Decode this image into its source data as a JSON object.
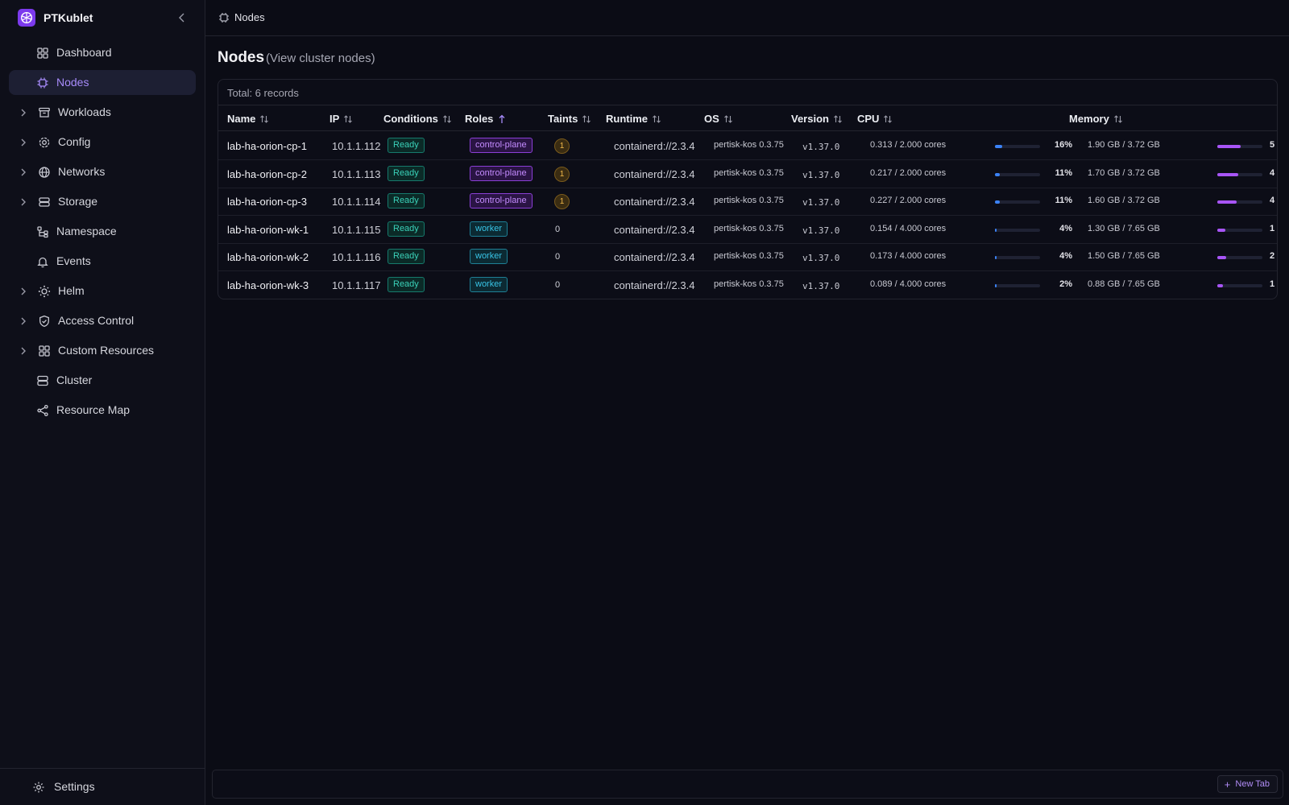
{
  "app": {
    "title": "PTKublet"
  },
  "sidebar": {
    "items": [
      {
        "label": "Dashboard",
        "icon": "dashboard-icon",
        "expandable": false,
        "active": false
      },
      {
        "label": "Nodes",
        "icon": "cpu-chip-icon",
        "expandable": false,
        "active": true
      },
      {
        "label": "Workloads",
        "icon": "archive-box-icon",
        "expandable": true,
        "active": false
      },
      {
        "label": "Config",
        "icon": "gear-icon",
        "expandable": true,
        "active": false
      },
      {
        "label": "Networks",
        "icon": "globe-icon",
        "expandable": true,
        "active": false
      },
      {
        "label": "Storage",
        "icon": "database-icon",
        "expandable": true,
        "active": false
      },
      {
        "label": "Namespace",
        "icon": "namespace-icon",
        "expandable": false,
        "active": false
      },
      {
        "label": "Events",
        "icon": "bell-icon",
        "expandable": false,
        "active": false
      },
      {
        "label": "Helm",
        "icon": "helm-icon",
        "expandable": true,
        "active": false
      },
      {
        "label": "Access Control",
        "icon": "shield-check-icon",
        "expandable": true,
        "active": false
      },
      {
        "label": "Custom Resources",
        "icon": "grid-icon",
        "expandable": true,
        "active": false
      },
      {
        "label": "Cluster",
        "icon": "server-stack-icon",
        "expandable": false,
        "active": false
      },
      {
        "label": "Resource Map",
        "icon": "share-nodes-icon",
        "expandable": false,
        "active": false
      }
    ],
    "footer": {
      "label": "Settings",
      "icon": "gear-icon"
    }
  },
  "breadcrumb": {
    "label": "Nodes",
    "icon": "cpu-chip-icon"
  },
  "page": {
    "title": "Nodes",
    "subtitle": "(View cluster nodes)"
  },
  "table": {
    "total_label": "Total: 6 records",
    "columns": [
      "Name",
      "IP",
      "Conditions",
      "Roles",
      "Taints",
      "Runtime",
      "OS",
      "Version",
      "CPU",
      "Memory"
    ],
    "rows": [
      {
        "name": "lab-ha-orion-cp-1",
        "ip": "10.1.1.112",
        "condition": "Ready",
        "role": "control-plane",
        "taints": "1",
        "runtime": "containerd://2.3.4",
        "os": "pertisk-kos 0.3.75",
        "version": "v1.37.0",
        "cpu": "0.313 / 2.000 cores",
        "cpu_pct": 16,
        "cpu_pct_label": "16%",
        "mem": "1.90 GB / 3.72 GB",
        "mem_pct": 51,
        "mem_pct_label": "5"
      },
      {
        "name": "lab-ha-orion-cp-2",
        "ip": "10.1.1.113",
        "condition": "Ready",
        "role": "control-plane",
        "taints": "1",
        "runtime": "containerd://2.3.4",
        "os": "pertisk-kos 0.3.75",
        "version": "v1.37.0",
        "cpu": "0.217 / 2.000 cores",
        "cpu_pct": 11,
        "cpu_pct_label": "11%",
        "mem": "1.70 GB / 3.72 GB",
        "mem_pct": 46,
        "mem_pct_label": "4"
      },
      {
        "name": "lab-ha-orion-cp-3",
        "ip": "10.1.1.114",
        "condition": "Ready",
        "role": "control-plane",
        "taints": "1",
        "runtime": "containerd://2.3.4",
        "os": "pertisk-kos 0.3.75",
        "version": "v1.37.0",
        "cpu": "0.227 / 2.000 cores",
        "cpu_pct": 11,
        "cpu_pct_label": "11%",
        "mem": "1.60 GB / 3.72 GB",
        "mem_pct": 43,
        "mem_pct_label": "4"
      },
      {
        "name": "lab-ha-orion-wk-1",
        "ip": "10.1.1.115",
        "condition": "Ready",
        "role": "worker",
        "taints": "0",
        "runtime": "containerd://2.3.4",
        "os": "pertisk-kos 0.3.75",
        "version": "v1.37.0",
        "cpu": "0.154 / 4.000 cores",
        "cpu_pct": 4,
        "cpu_pct_label": "4%",
        "mem": "1.30 GB / 7.65 GB",
        "mem_pct": 17,
        "mem_pct_label": "1"
      },
      {
        "name": "lab-ha-orion-wk-2",
        "ip": "10.1.1.116",
        "condition": "Ready",
        "role": "worker",
        "taints": "0",
        "runtime": "containerd://2.3.4",
        "os": "pertisk-kos 0.3.75",
        "version": "v1.37.0",
        "cpu": "0.173 / 4.000 cores",
        "cpu_pct": 4,
        "cpu_pct_label": "4%",
        "mem": "1.50 GB / 7.65 GB",
        "mem_pct": 20,
        "mem_pct_label": "2"
      },
      {
        "name": "lab-ha-orion-wk-3",
        "ip": "10.1.1.117",
        "condition": "Ready",
        "role": "worker",
        "taints": "0",
        "runtime": "containerd://2.3.4",
        "os": "pertisk-kos 0.3.75",
        "version": "v1.37.0",
        "cpu": "0.089 / 4.000 cores",
        "cpu_pct": 2,
        "cpu_pct_label": "2%",
        "mem": "0.88 GB / 7.65 GB",
        "mem_pct": 12,
        "mem_pct_label": "1"
      }
    ]
  },
  "tabs_bar": {
    "new_tab_label": "New Tab"
  },
  "colors": {
    "accent": "#a78bfa",
    "ready": "#3ad1b8",
    "control_plane": "#c48bff",
    "worker": "#38c4e6",
    "taint": "#f0b84a",
    "cpu_bar": "#3b82f6",
    "mem_bar": "#a855f7"
  }
}
